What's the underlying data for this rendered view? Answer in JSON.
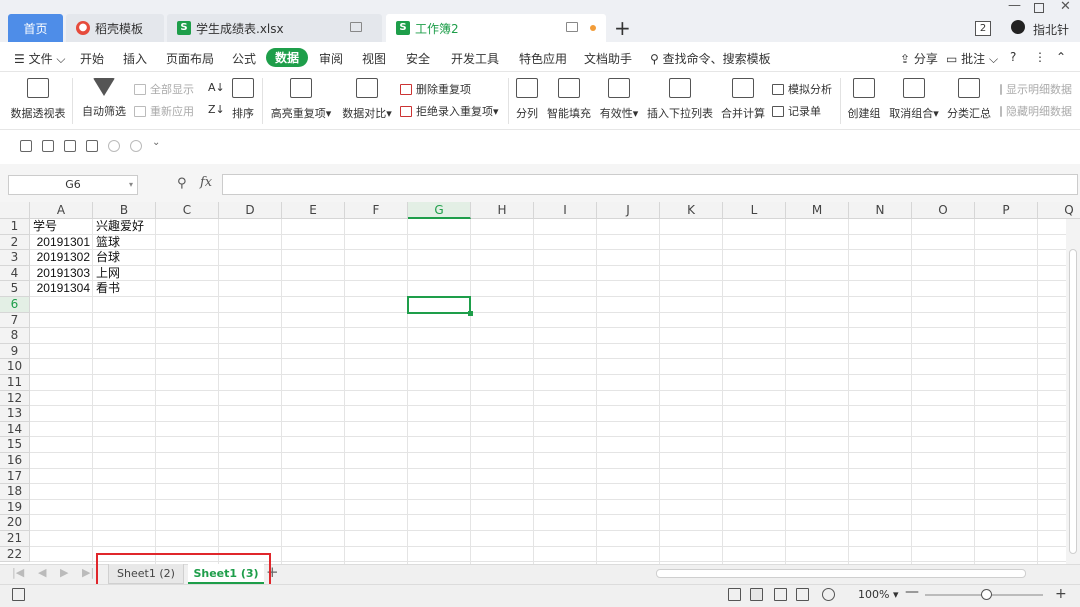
{
  "tabs": {
    "home": "首页",
    "daoke": "稻壳模板",
    "xlsx": "学生成绩表.xlsx",
    "workbook2": "工作簿2"
  },
  "titlebar": {
    "badge": "2",
    "user_name": "指北针"
  },
  "menu": {
    "file": "文件",
    "items": [
      "开始",
      "插入",
      "页面布局",
      "公式",
      "数据",
      "审阅",
      "视图",
      "安全",
      "开发工具",
      "特色应用",
      "文档助手"
    ],
    "active": "数据",
    "search": "查找命令、搜索模板",
    "share": "分享",
    "comment": "批注"
  },
  "ribbon": {
    "pivot": "数据透视表",
    "autofilter": "自动筛选",
    "show_all": "全部显示",
    "reapply": "重新应用",
    "sort": "排序",
    "highlight_dup": "高亮重复项",
    "compare": "数据对比",
    "remove_dup": "删除重复项",
    "reject_dup": "拒绝录入重复项",
    "split": "分列",
    "smart_fill": "智能填充",
    "validity": "有效性",
    "insert_dropdown": "插入下拉列表",
    "consolidate": "合并计算",
    "what_if": "模拟分析",
    "record_form": "记录单",
    "group": "创建组",
    "ungroup": "取消组合",
    "subtotal": "分类汇总",
    "show_detail": "显示明细数据",
    "hide_detail": "隐藏明细数据"
  },
  "formula_bar": {
    "cell_ref": "G6",
    "fx": "fx",
    "content": ""
  },
  "grid": {
    "columns": [
      "A",
      "B",
      "C",
      "D",
      "E",
      "F",
      "G",
      "H",
      "I",
      "J",
      "K",
      "L",
      "M",
      "N",
      "O",
      "P",
      "Q"
    ],
    "selected_column": "G",
    "selected_row": 6,
    "rows": [
      "1",
      "2",
      "3",
      "4",
      "5",
      "6",
      "7",
      "8",
      "9",
      "10",
      "11",
      "12",
      "13",
      "14",
      "15",
      "16",
      "17",
      "18",
      "19",
      "20",
      "21",
      "22"
    ],
    "cells": [
      [
        "学号",
        "兴趣爱好"
      ],
      [
        "20191301",
        "篮球"
      ],
      [
        "20191302",
        "台球"
      ],
      [
        "20191303",
        "上网"
      ],
      [
        "20191304",
        "看书"
      ]
    ]
  },
  "sheets": {
    "sheet1": "Sheet1 (2)",
    "sheet2": "Sheet1 (3)",
    "active": "Sheet1 (3)"
  },
  "status": {
    "zoom": "100%"
  },
  "colors": {
    "accent": "#1e9e4a",
    "home_tab": "#4e8de8",
    "highlight": "#e0262b"
  }
}
